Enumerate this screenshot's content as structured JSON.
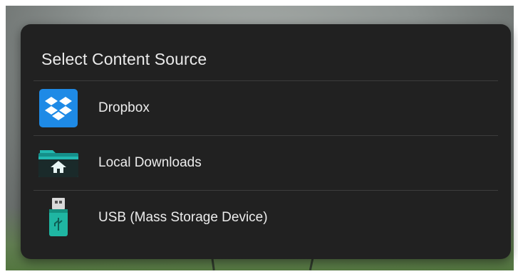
{
  "dialog": {
    "title": "Select Content Source",
    "options": [
      {
        "label": "Dropbox",
        "icon": "dropbox-icon"
      },
      {
        "label": "Local Downloads",
        "icon": "folder-home-icon"
      },
      {
        "label": "USB (Mass Storage Device)",
        "icon": "usb-drive-icon"
      }
    ]
  },
  "colors": {
    "dialog_background": "#212121",
    "dropbox_blue": "#1e8ae6",
    "folder_teal": "#22b8b0",
    "usb_teal": "#1fb6a2"
  }
}
